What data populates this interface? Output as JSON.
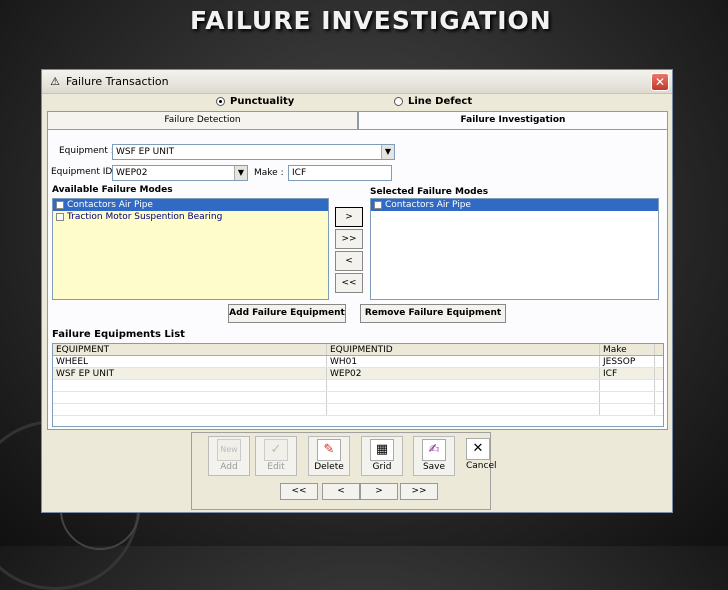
{
  "slide": {
    "title": "Failure Investigation"
  },
  "window": {
    "title": "Failure Transaction",
    "close_symbol": "✕"
  },
  "mode": {
    "option_punctuality": "Punctuality",
    "option_line_defect": "Line Defect",
    "selected": "Punctuality"
  },
  "tabs": [
    {
      "label": "Failure Detection",
      "active": false
    },
    {
      "label": "Failure Investigation",
      "active": true
    }
  ],
  "form": {
    "equipment_label": "Equipment :",
    "equipment_value": "WSF EP UNIT",
    "equipment_id_label": "Equipment ID :",
    "equipment_id_value": "WEP02",
    "make_label": "Make :",
    "make_value": "ICF"
  },
  "available": {
    "heading": "Available Failure Modes",
    "items": [
      {
        "label": "Contactors Air Pipe",
        "selected": true
      },
      {
        "label": "Traction Motor Suspention Bearing",
        "selected": false
      }
    ]
  },
  "selected_modes": {
    "heading": "Selected Failure Modes",
    "items": [
      {
        "label": "Contactors Air Pipe",
        "selected": true
      }
    ]
  },
  "move_buttons": {
    "add_one": ">",
    "add_all": ">>",
    "remove_one": "<",
    "remove_all": "<<"
  },
  "actions": {
    "add_failure_equipment": "Add Failure Equipment",
    "remove_failure_equipment": "Remove Failure Equipment"
  },
  "equipment_list": {
    "heading": "Failure Equipments List",
    "columns": [
      "EQUIPMENT",
      "EQUIPMENTID",
      "Make"
    ],
    "rows": [
      [
        "WHEEL",
        "WH01",
        "JESSOP"
      ],
      [
        "WSF EP UNIT",
        "WEP02",
        "ICF"
      ]
    ]
  },
  "toolbar": {
    "buttons": [
      {
        "label": "Add",
        "icon": "new-icon",
        "glyph": "New",
        "enabled": false
      },
      {
        "label": "Edit",
        "icon": "check-icon",
        "glyph": "✓",
        "enabled": false
      },
      {
        "label": "Delete",
        "icon": "eraser-icon",
        "glyph": "✎",
        "enabled": true
      },
      {
        "label": "Grid",
        "icon": "grid-icon",
        "glyph": "▦",
        "enabled": true
      },
      {
        "label": "Save",
        "icon": "save-icon",
        "glyph": "✍",
        "enabled": true
      },
      {
        "label": "Cancel",
        "icon": "cancel-icon",
        "glyph": "✕",
        "enabled": true
      }
    ],
    "nav": {
      "first": "<<",
      "prev": "<",
      "next": ">",
      "last": ">>"
    }
  }
}
